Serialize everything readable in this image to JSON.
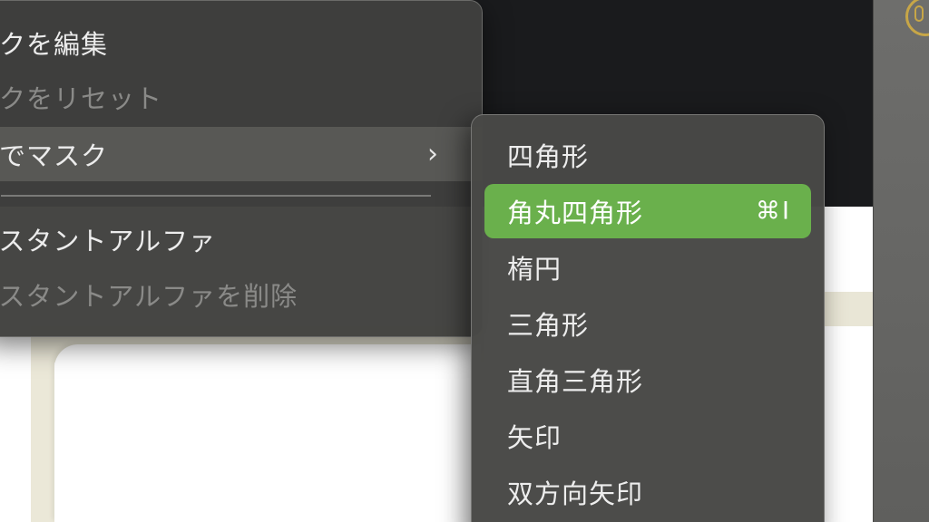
{
  "menu": {
    "items": [
      {
        "label": "スクを編集"
      },
      {
        "label": "スクをリセット"
      },
      {
        "label": "形でマスク",
        "chevron": "›"
      },
      {
        "label": "ンスタントアルファ"
      },
      {
        "label": "ンスタントアルファを削除"
      }
    ]
  },
  "submenu": {
    "items": [
      {
        "label": "四角形"
      },
      {
        "label": "角丸四角形",
        "shortcut": "⌘I"
      },
      {
        "label": "楕円"
      },
      {
        "label": "三角形"
      },
      {
        "label": "直角三角形"
      },
      {
        "label": "矢印"
      },
      {
        "label": "双方向矢印"
      }
    ]
  },
  "colors": {
    "menu_bg": "#40403e",
    "selected_bg": "#6ab04c",
    "text": "#ececec",
    "disabled_text": "#8a8a88"
  }
}
